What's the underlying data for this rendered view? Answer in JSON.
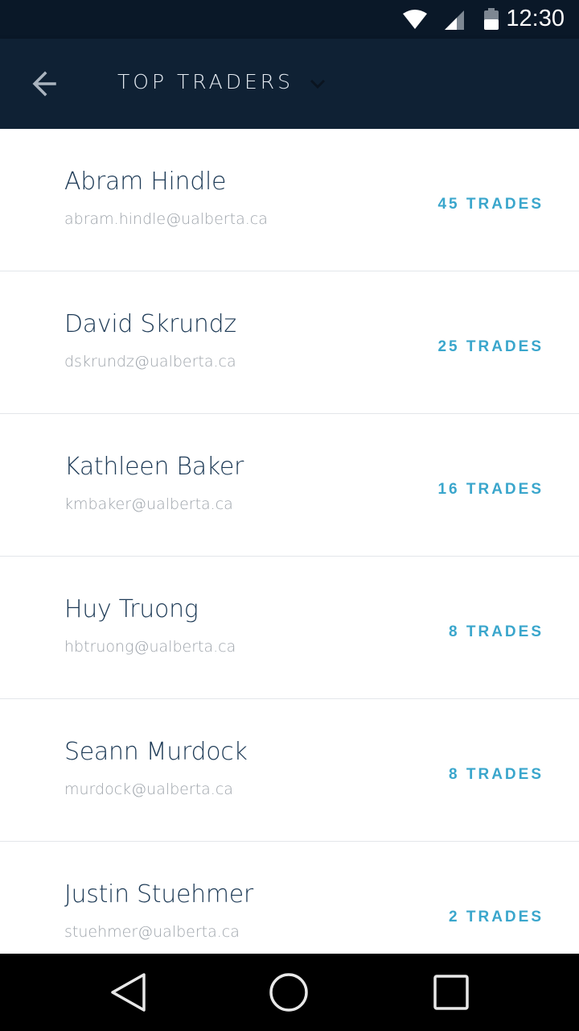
{
  "status_bar": {
    "time": "12:30",
    "icons": [
      "wifi-icon",
      "signal-icon",
      "battery-icon"
    ]
  },
  "app_bar": {
    "title": "TOP TRADERS",
    "icons": [
      "back-arrow-icon",
      "chevron-down-icon"
    ]
  },
  "traders": [
    {
      "name": "Abram Hindle",
      "email": "abram.hindle@ualberta.ca",
      "trades": "45 TRADES"
    },
    {
      "name": "David Skrundz",
      "email": "dskrundz@ualberta.ca",
      "trades": "25 TRADES"
    },
    {
      "name": "Kathleen Baker",
      "email": "kmbaker@ualberta.ca",
      "trades": "16 TRADES"
    },
    {
      "name": "Huy Truong",
      "email": "hbtruong@ualberta.ca",
      "trades": "8 TRADES"
    },
    {
      "name": "Seann Murdock",
      "email": "murdock@ualberta.ca",
      "trades": "8 TRADES"
    },
    {
      "name": "Justin Stuehmer",
      "email": "stuehmer@ualberta.ca",
      "trades": "2 TRADES"
    }
  ],
  "nav_bar": {
    "icons": [
      "back-triangle-icon",
      "home-circle-icon",
      "recents-square-icon"
    ]
  },
  "colors": {
    "status_bar": "#0a1828",
    "app_bar": "#0f2134",
    "name_text": "#1d3a56",
    "email_text": "#9ea4ab",
    "trades_accent": "#3aa6cc"
  }
}
